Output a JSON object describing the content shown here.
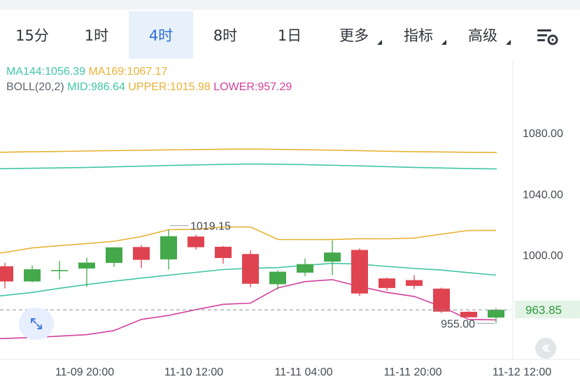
{
  "tabs": [
    {
      "label": "15分",
      "active": false,
      "dropdown": false
    },
    {
      "label": "1时",
      "active": false,
      "dropdown": false
    },
    {
      "label": "4时",
      "active": true,
      "dropdown": false
    },
    {
      "label": "8时",
      "active": false,
      "dropdown": false
    },
    {
      "label": "1日",
      "active": false,
      "dropdown": false
    },
    {
      "label": "更多",
      "active": false,
      "dropdown": true
    },
    {
      "label": "指标",
      "active": false,
      "dropdown": true
    },
    {
      "label": "高级",
      "active": false,
      "dropdown": true
    }
  ],
  "icons": {
    "settings": "chart-settings-icon",
    "expand": "expand-arrows-icon",
    "collapse": "double-chevron-left-icon"
  },
  "legend": {
    "ma144": "MA144:1056.39",
    "ma169": "MA169:1067.17",
    "boll": "BOLL(20,2)",
    "mid": "MID:986.64",
    "upper": "UPPER:1015.98",
    "lower": "LOWER:957.29"
  },
  "colors": {
    "up": "#44a94b",
    "down": "#e04350",
    "ma144": "#41c5a6",
    "ma169": "#e9b236",
    "mid": "#41c5a6",
    "upper": "#e9b236",
    "lower": "#d2409c",
    "accent": "#2f6fd6"
  },
  "chart_data": {
    "type": "candlestick",
    "y_ticks": [
      "1080.00",
      "1040.00",
      "1000.00"
    ],
    "ylim": [
      935,
      1105
    ],
    "x_ticks": [
      "11-09 20:00",
      "11-10 12:00",
      "11-11 04:00",
      "11-11 20:00",
      "11-12 12:00"
    ],
    "last_price": "963.85",
    "annotations": {
      "high": "1019.15",
      "low": "955.00"
    },
    "candles": [
      {
        "open": 992.5,
        "close": 982.5,
        "high": 994.8,
        "low": 977.9
      },
      {
        "open": 982.5,
        "close": 990.5,
        "high": 993.1,
        "low": 982.0
      },
      {
        "open": 990.0,
        "close": 990.0,
        "high": 996.0,
        "low": 983.8
      },
      {
        "open": 991.0,
        "close": 994.9,
        "high": 998.1,
        "low": 979.0
      },
      {
        "open": 994.7,
        "close": 1004.9,
        "high": 1004.9,
        "low": 992.2
      },
      {
        "open": 1005.1,
        "close": 996.7,
        "high": 1006.4,
        "low": 991.2
      },
      {
        "open": 997.0,
        "close": 1012.2,
        "high": 1016.5,
        "low": 990.4
      },
      {
        "open": 1012.0,
        "close": 1005.0,
        "high": 1013.2,
        "low": 1003.5
      },
      {
        "open": 1005.3,
        "close": 997.9,
        "high": 1005.8,
        "low": 994.2
      },
      {
        "open": 1000.5,
        "close": 981.0,
        "high": 1002.9,
        "low": 978.8
      },
      {
        "open": 980.7,
        "close": 988.9,
        "high": 989.9,
        "low": 977.1
      },
      {
        "open": 988.3,
        "close": 993.9,
        "high": 997.6,
        "low": 986.0
      },
      {
        "open": 995.5,
        "close": 1001.5,
        "high": 1009.4,
        "low": 986.7
      },
      {
        "open": 1003.2,
        "close": 974.6,
        "high": 1004.2,
        "low": 973.0
      },
      {
        "open": 984.5,
        "close": 978.2,
        "high": 985.1,
        "low": 976.5
      },
      {
        "open": 983.4,
        "close": 979.6,
        "high": 986.6,
        "low": 977.6
      },
      {
        "open": 977.8,
        "close": 962.7,
        "high": 978.5,
        "low": 961.8
      },
      {
        "open": 962.6,
        "close": 959.0,
        "high": 962.9,
        "low": 958.8
      },
      {
        "open": 958.8,
        "close": 963.9,
        "high": 965.0,
        "low": 955.0
      }
    ],
    "series": [
      {
        "name": "MA144",
        "values": [
          1056.5,
          1056.8,
          1057.0,
          1057.3,
          1057.7,
          1058.1,
          1058.6,
          1059.0,
          1059.3,
          1059.6,
          1059.5,
          1059.2,
          1058.8,
          1058.4,
          1057.9,
          1057.4,
          1057.0,
          1056.6,
          1056.39
        ]
      },
      {
        "name": "MA169",
        "values": [
          1067.3,
          1067.6,
          1067.8,
          1068.1,
          1068.4,
          1068.6,
          1068.9,
          1069.1,
          1069.3,
          1069.4,
          1069.2,
          1069.0,
          1068.7,
          1068.4,
          1068.0,
          1067.7,
          1067.5,
          1067.3,
          1067.17
        ]
      },
      {
        "name": "MID",
        "values": [
          973.0,
          975.3,
          978.0,
          980.5,
          982.7,
          984.7,
          986.6,
          988.5,
          990.3,
          991.2,
          991.6,
          993.1,
          994.4,
          993.9,
          992.4,
          991.1,
          990.0,
          988.3,
          986.64
        ]
      },
      {
        "name": "UPPER",
        "values": [
          1001.1,
          1004.5,
          1006.0,
          1007.4,
          1008.9,
          1012.0,
          1016.5,
          1016.8,
          1018.2,
          1018.3,
          1010.1,
          1010.0,
          1010.0,
          1010.6,
          1010.5,
          1011.0,
          1013.6,
          1016.0,
          1015.98
        ]
      },
      {
        "name": "LOWER",
        "values": [
          945.0,
          945.7,
          946.6,
          947.6,
          950.3,
          957.6,
          960.2,
          964.0,
          967.5,
          968.3,
          978.3,
          982.4,
          983.7,
          979.2,
          975.3,
          972.7,
          966.0,
          957.6,
          957.29
        ]
      }
    ]
  }
}
